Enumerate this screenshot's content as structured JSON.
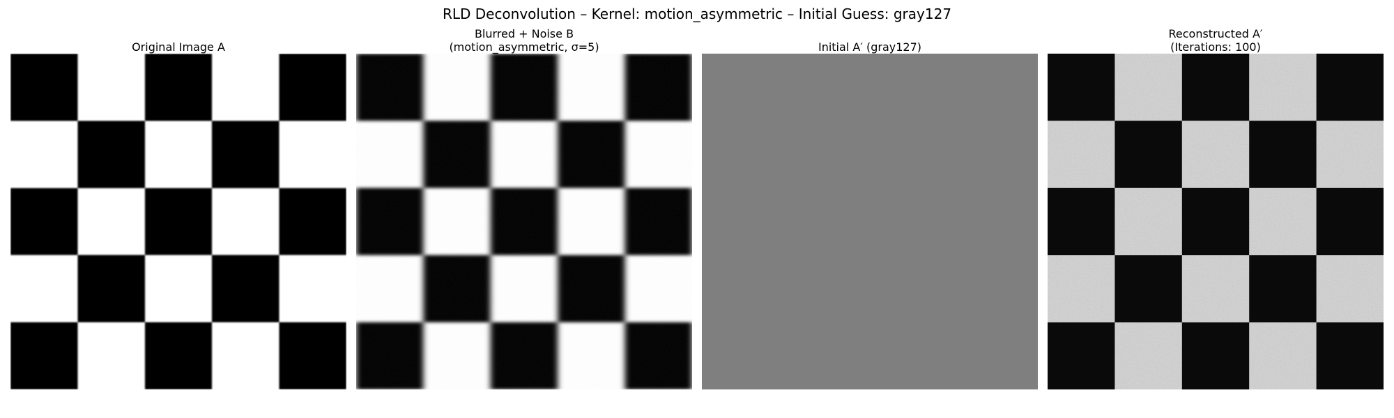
{
  "figure": {
    "title": "RLD Deconvolution – Kernel: motion_asymmetric – Initial Guess: gray127"
  },
  "panels": [
    {
      "title_lines": [
        "Original Image A"
      ],
      "image": "checkerboard-sharp"
    },
    {
      "title_lines": [
        "Blurred + Noise B",
        "(motion_asymmetric, σ=5)"
      ],
      "image": "checkerboard-blurred"
    },
    {
      "title_lines": [
        "Initial A′ (gray127)"
      ],
      "image": "uniform-gray-127"
    },
    {
      "title_lines": [
        "Reconstructed A′",
        "(Iterations: 100)"
      ],
      "image": "checkerboard-noisy-reconstruction"
    }
  ],
  "colors": {
    "dark_square": "#000000",
    "light_square": "#ffffff",
    "initial_gray": "#7f7f7f",
    "reconstructed_light": "#d2d2d2",
    "reconstructed_dark": "#0a0a0a"
  }
}
